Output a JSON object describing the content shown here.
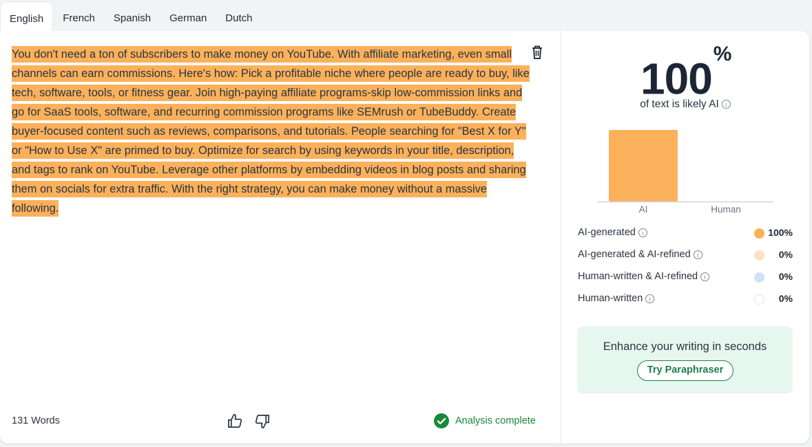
{
  "tabs": [
    "English",
    "French",
    "Spanish",
    "German",
    "Dutch"
  ],
  "active_tab": "English",
  "input_text": "You don't need a ton of subscribers to make money on YouTube. With affiliate marketing, even small channels can earn commissions. Here's how: Pick a profitable niche where people are ready to buy, like tech, software, tools, or fitness gear. Join high-paying affiliate programs-skip low-commission links and go for SaaS tools, software, and recurring commission programs like SEMrush or TubeBuddy. Create buyer-focused content such as reviews, comparisons, and tutorials. People searching for \"Best X for Y\" or \"How to Use X\" are primed to buy. Optimize for search by using keywords in your title, description, and tags to rank on YouTube. Leverage other platforms by embedding videos in blog posts and sharing them on socials for extra traffic. With the right strategy, you can make money without a massive following.",
  "word_count": "131 Words",
  "status": "Analysis complete",
  "score": {
    "value": "100",
    "unit": "%",
    "caption": "of text is likely AI"
  },
  "chart_data": {
    "type": "bar",
    "categories": [
      "AI",
      "Human"
    ],
    "values": [
      100,
      0
    ],
    "ylim": [
      0,
      100
    ],
    "colors": [
      "#fbb15b",
      "#c9d9f2"
    ]
  },
  "breakdown": [
    {
      "label": "AI-generated",
      "value": "100%",
      "color": "#fbb15b"
    },
    {
      "label": "AI-generated & AI-refined",
      "value": "0%",
      "color": "#fde2c4"
    },
    {
      "label": "Human-written & AI-refined",
      "value": "0%",
      "color": "#cfe0f7"
    },
    {
      "label": "Human-written",
      "value": "0%",
      "color": "#ffffff"
    }
  ],
  "promo": {
    "text": "Enhance your writing in seconds",
    "button": "Try Paraphraser"
  },
  "colors": {
    "highlight": "#fbb15b",
    "success": "#178a3a",
    "promo_bg": "#e6f7ef"
  },
  "icons": [
    "trash-icon",
    "thumbs-up-icon",
    "thumbs-down-icon",
    "check-circle-icon",
    "info-icon"
  ]
}
